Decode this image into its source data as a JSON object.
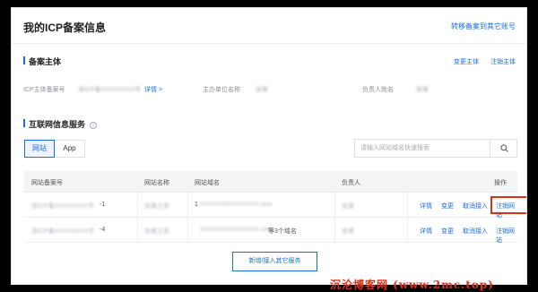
{
  "page": {
    "title": "我的ICP备案信息",
    "transfer_link": "转移备案到其它账号"
  },
  "subject": {
    "heading": "备案主体",
    "change_link": "变更主体",
    "cancel_link": "注销主体",
    "fields": [
      {
        "label": "ICP主体备案号",
        "value": "浙ICP备XXXXXXXX号",
        "detail": "详情 >"
      },
      {
        "label": "主办单位名称",
        "value": "张某"
      },
      {
        "label": "负责人姓名",
        "value": "张某"
      }
    ]
  },
  "services": {
    "heading": "互联网信息服务",
    "info_icon": "i",
    "tabs": [
      {
        "label": "网站"
      },
      {
        "label": "App"
      }
    ],
    "search_placeholder": "请输入网站域名快速搜索",
    "columns": [
      "网站备案号",
      "网站名称",
      "网站域名",
      "负责人",
      "操作"
    ],
    "rows": [
      {
        "record_no": "浙ICP备XXXXXXXX号",
        "record_suffix": "-1",
        "name": "张某之家",
        "domain_prefix": "1",
        "domain": "XXXXXXXXXXXXXX.com",
        "domain_extra": "",
        "owner": "张某",
        "actions": [
          "详情",
          "变更",
          "取消接入",
          "注销网站"
        ]
      },
      {
        "record_no": "浙ICP备XXXXXXXX号",
        "record_suffix": "-4",
        "name": "张某之家",
        "domain_prefix": "",
        "domain": "XXXXXXXXXXXXXX.com",
        "domain_extra": "等3个域名",
        "owner": "张某",
        "actions": [
          "详情",
          "变更",
          "取消接入",
          "注销网站"
        ]
      }
    ],
    "add_button": "新增/接入其它服务"
  },
  "watermark": "沉沦博客网 (www.2mc.top)",
  "colors": {
    "accent": "#1a6fe0",
    "highlight": "#d9331c"
  }
}
